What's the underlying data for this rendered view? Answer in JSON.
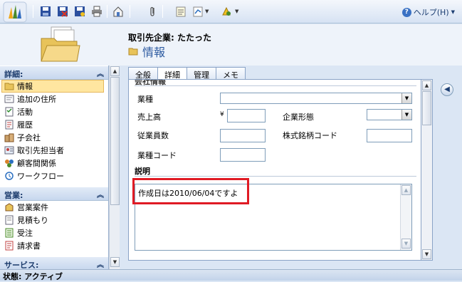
{
  "toolbar": {
    "buttons": [
      "save-icon",
      "save-close-icon",
      "save-new-icon",
      "print-icon",
      "assign-icon",
      "attach-icon",
      "note-icon",
      "report-icon",
      "workflow-icon"
    ],
    "help_label": "ヘルプ(H)"
  },
  "header": {
    "record_type": "取引先企業: たたった",
    "record_name": "情報"
  },
  "nav": {
    "details_title": "詳細:",
    "details_items": [
      {
        "label": "情報",
        "icon": "form-icon"
      },
      {
        "label": "追加の住所",
        "icon": "address-icon"
      },
      {
        "label": "活動",
        "icon": "activity-icon"
      },
      {
        "label": "履歴",
        "icon": "history-icon"
      },
      {
        "label": "子会社",
        "icon": "subsidiary-icon"
      },
      {
        "label": "取引先担当者",
        "icon": "contact-icon"
      },
      {
        "label": "顧客間関係",
        "icon": "relationship-icon"
      },
      {
        "label": "ワークフロー",
        "icon": "workflow-icon"
      }
    ],
    "sales_title": "営業:",
    "sales_items": [
      {
        "label": "営業案件",
        "icon": "opportunity-icon"
      },
      {
        "label": "見積もり",
        "icon": "quote-icon"
      },
      {
        "label": "受注",
        "icon": "order-icon"
      },
      {
        "label": "請求書",
        "icon": "invoice-icon"
      }
    ],
    "service_title": "サービス:"
  },
  "tabs": [
    "全般",
    "詳細",
    "管理",
    "メモ"
  ],
  "active_tab": "詳細",
  "form": {
    "section_title": "会社情報",
    "industry_label": "業種",
    "revenue_label": "売上高",
    "currency_symbol": "¥",
    "ownership_label": "企業形態",
    "employees_label": "従業員数",
    "ticker_label": "株式銘柄コード",
    "sic_label": "業種コード",
    "description_title": "説明",
    "description_value": "作成日は2010/06/04ですよ"
  },
  "status": {
    "text": "状態: アクティブ"
  },
  "colors": {
    "highlight": "#e01b24",
    "accent": "#2c5aa0"
  }
}
